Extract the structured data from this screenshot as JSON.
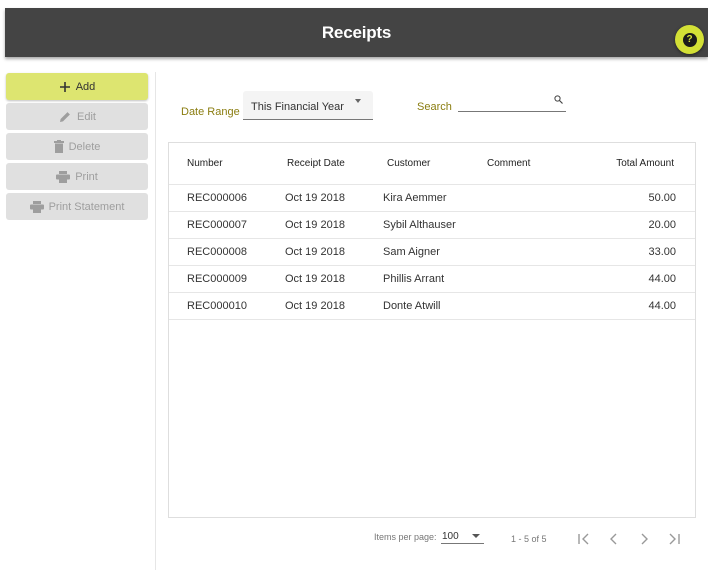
{
  "header": {
    "title": "Receipts",
    "help_icon": "question-circle-icon",
    "help_glyph": "?"
  },
  "colors": {
    "header_bg": "#444444",
    "accent": "#d3e036",
    "primary_button": "#dde570",
    "label_color": "#8a7d10"
  },
  "sidebar": {
    "buttons": [
      {
        "label": "Add",
        "icon": "plus-icon",
        "enabled": true
      },
      {
        "label": "Edit",
        "icon": "pencil-icon",
        "enabled": false
      },
      {
        "label": "Delete",
        "icon": "trash-icon",
        "enabled": false
      },
      {
        "label": "Print",
        "icon": "printer-icon",
        "enabled": false
      },
      {
        "label": "Print Statement",
        "icon": "printer-icon",
        "enabled": false
      }
    ]
  },
  "filters": {
    "date_range_label": "Date Range",
    "date_range_value": "This Financial Year",
    "search_label": "Search",
    "search_value": "",
    "search_icon": "search-icon"
  },
  "table": {
    "columns": [
      "Number",
      "Receipt Date",
      "Customer",
      "Comment",
      "Total Amount"
    ],
    "rows": [
      {
        "number": "REC000006",
        "date": "Oct 19 2018",
        "customer": "Kira Aemmer",
        "comment": "",
        "amount": "50.00"
      },
      {
        "number": "REC000007",
        "date": "Oct 19 2018",
        "customer": "Sybil Althauser",
        "comment": "",
        "amount": "20.00"
      },
      {
        "number": "REC000008",
        "date": "Oct 19 2018",
        "customer": "Sam Aigner",
        "comment": "",
        "amount": "33.00"
      },
      {
        "number": "REC000009",
        "date": "Oct 19 2018",
        "customer": "Phillis Arrant",
        "comment": "",
        "amount": "44.00"
      },
      {
        "number": "REC000010",
        "date": "Oct 19 2018",
        "customer": "Donte Atwill",
        "comment": "",
        "amount": "44.00"
      }
    ]
  },
  "paginator": {
    "items_per_page_label": "Items per page:",
    "items_per_page_value": "100",
    "range_label": "1 - 5 of 5",
    "buttons": [
      "first-page-icon",
      "previous-page-icon",
      "next-page-icon",
      "last-page-icon"
    ]
  }
}
